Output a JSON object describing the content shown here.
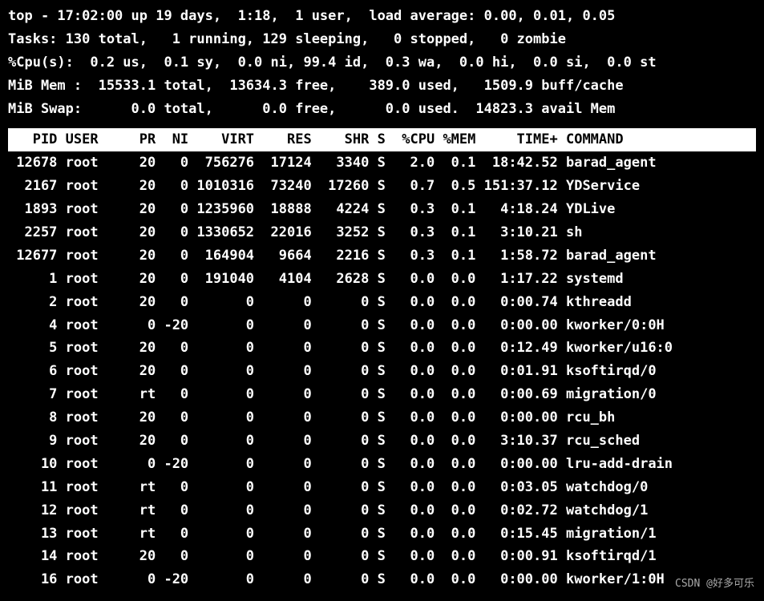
{
  "summary": {
    "line1": "top - 17:02:00 up 19 days,  1:18,  1 user,  load average: 0.00, 0.01, 0.05",
    "line2": "Tasks: 130 total,   1 running, 129 sleeping,   0 stopped,   0 zombie",
    "line3": "%Cpu(s):  0.2 us,  0.1 sy,  0.0 ni, 99.4 id,  0.3 wa,  0.0 hi,  0.0 si,  0.0 st",
    "line4": "MiB Mem :  15533.1 total,  13634.3 free,    389.0 used,   1509.9 buff/cache",
    "line5": "MiB Swap:      0.0 total,      0.0 free,      0.0 used.  14823.3 avail Mem"
  },
  "columns": [
    "PID",
    "USER",
    "PR",
    "NI",
    "VIRT",
    "RES",
    "SHR",
    "S",
    "%CPU",
    "%MEM",
    "TIME+",
    "COMMAND"
  ],
  "processes": [
    {
      "pid": "12678",
      "user": "root",
      "pr": "20",
      "ni": "0",
      "virt": "756276",
      "res": "17124",
      "shr": "3340",
      "s": "S",
      "cpu": "2.0",
      "mem": "0.1",
      "time": "18:42.52",
      "cmd": "barad_agent"
    },
    {
      "pid": "2167",
      "user": "root",
      "pr": "20",
      "ni": "0",
      "virt": "1010316",
      "res": "73240",
      "shr": "17260",
      "s": "S",
      "cpu": "0.7",
      "mem": "0.5",
      "time": "151:37.12",
      "cmd": "YDService"
    },
    {
      "pid": "1893",
      "user": "root",
      "pr": "20",
      "ni": "0",
      "virt": "1235960",
      "res": "18888",
      "shr": "4224",
      "s": "S",
      "cpu": "0.3",
      "mem": "0.1",
      "time": "4:18.24",
      "cmd": "YDLive"
    },
    {
      "pid": "2257",
      "user": "root",
      "pr": "20",
      "ni": "0",
      "virt": "1330652",
      "res": "22016",
      "shr": "3252",
      "s": "S",
      "cpu": "0.3",
      "mem": "0.1",
      "time": "3:10.21",
      "cmd": "sh"
    },
    {
      "pid": "12677",
      "user": "root",
      "pr": "20",
      "ni": "0",
      "virt": "164904",
      "res": "9664",
      "shr": "2216",
      "s": "S",
      "cpu": "0.3",
      "mem": "0.1",
      "time": "1:58.72",
      "cmd": "barad_agent"
    },
    {
      "pid": "1",
      "user": "root",
      "pr": "20",
      "ni": "0",
      "virt": "191040",
      "res": "4104",
      "shr": "2628",
      "s": "S",
      "cpu": "0.0",
      "mem": "0.0",
      "time": "1:17.22",
      "cmd": "systemd"
    },
    {
      "pid": "2",
      "user": "root",
      "pr": "20",
      "ni": "0",
      "virt": "0",
      "res": "0",
      "shr": "0",
      "s": "S",
      "cpu": "0.0",
      "mem": "0.0",
      "time": "0:00.74",
      "cmd": "kthreadd"
    },
    {
      "pid": "4",
      "user": "root",
      "pr": "0",
      "ni": "-20",
      "virt": "0",
      "res": "0",
      "shr": "0",
      "s": "S",
      "cpu": "0.0",
      "mem": "0.0",
      "time": "0:00.00",
      "cmd": "kworker/0:0H"
    },
    {
      "pid": "5",
      "user": "root",
      "pr": "20",
      "ni": "0",
      "virt": "0",
      "res": "0",
      "shr": "0",
      "s": "S",
      "cpu": "0.0",
      "mem": "0.0",
      "time": "0:12.49",
      "cmd": "kworker/u16:0"
    },
    {
      "pid": "6",
      "user": "root",
      "pr": "20",
      "ni": "0",
      "virt": "0",
      "res": "0",
      "shr": "0",
      "s": "S",
      "cpu": "0.0",
      "mem": "0.0",
      "time": "0:01.91",
      "cmd": "ksoftirqd/0"
    },
    {
      "pid": "7",
      "user": "root",
      "pr": "rt",
      "ni": "0",
      "virt": "0",
      "res": "0",
      "shr": "0",
      "s": "S",
      "cpu": "0.0",
      "mem": "0.0",
      "time": "0:00.69",
      "cmd": "migration/0"
    },
    {
      "pid": "8",
      "user": "root",
      "pr": "20",
      "ni": "0",
      "virt": "0",
      "res": "0",
      "shr": "0",
      "s": "S",
      "cpu": "0.0",
      "mem": "0.0",
      "time": "0:00.00",
      "cmd": "rcu_bh"
    },
    {
      "pid": "9",
      "user": "root",
      "pr": "20",
      "ni": "0",
      "virt": "0",
      "res": "0",
      "shr": "0",
      "s": "S",
      "cpu": "0.0",
      "mem": "0.0",
      "time": "3:10.37",
      "cmd": "rcu_sched"
    },
    {
      "pid": "10",
      "user": "root",
      "pr": "0",
      "ni": "-20",
      "virt": "0",
      "res": "0",
      "shr": "0",
      "s": "S",
      "cpu": "0.0",
      "mem": "0.0",
      "time": "0:00.00",
      "cmd": "lru-add-drain"
    },
    {
      "pid": "11",
      "user": "root",
      "pr": "rt",
      "ni": "0",
      "virt": "0",
      "res": "0",
      "shr": "0",
      "s": "S",
      "cpu": "0.0",
      "mem": "0.0",
      "time": "0:03.05",
      "cmd": "watchdog/0"
    },
    {
      "pid": "12",
      "user": "root",
      "pr": "rt",
      "ni": "0",
      "virt": "0",
      "res": "0",
      "shr": "0",
      "s": "S",
      "cpu": "0.0",
      "mem": "0.0",
      "time": "0:02.72",
      "cmd": "watchdog/1"
    },
    {
      "pid": "13",
      "user": "root",
      "pr": "rt",
      "ni": "0",
      "virt": "0",
      "res": "0",
      "shr": "0",
      "s": "S",
      "cpu": "0.0",
      "mem": "0.0",
      "time": "0:15.45",
      "cmd": "migration/1"
    },
    {
      "pid": "14",
      "user": "root",
      "pr": "20",
      "ni": "0",
      "virt": "0",
      "res": "0",
      "shr": "0",
      "s": "S",
      "cpu": "0.0",
      "mem": "0.0",
      "time": "0:00.91",
      "cmd": "ksoftirqd/1"
    },
    {
      "pid": "16",
      "user": "root",
      "pr": "0",
      "ni": "-20",
      "virt": "0",
      "res": "0",
      "shr": "0",
      "s": "S",
      "cpu": "0.0",
      "mem": "0.0",
      "time": "0:00.00",
      "cmd": "kworker/1:0H"
    }
  ],
  "watermark": "CSDN @好多可乐"
}
